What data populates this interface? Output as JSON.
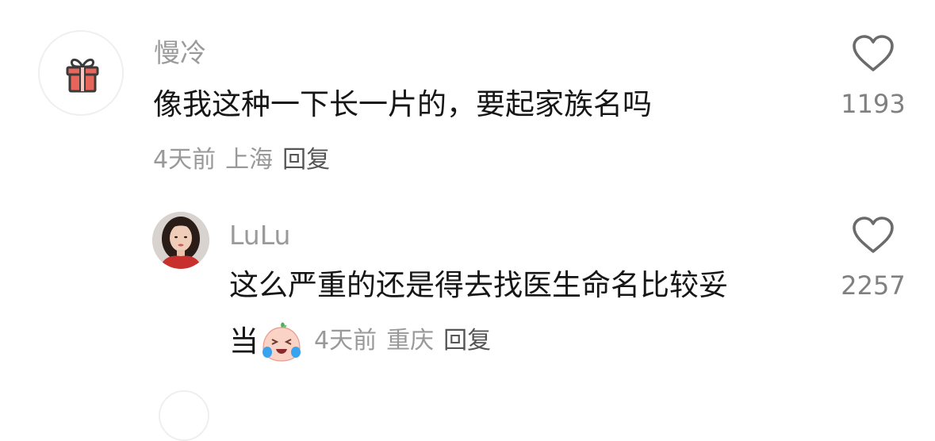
{
  "comments": [
    {
      "username": "慢冷",
      "avatar_icon": "gift-icon",
      "text": "像我这种一下长一片的，要起家族名吗",
      "time": "4天前",
      "location": "上海",
      "reply_label": "回复",
      "like_icon": "heart-outline-icon",
      "like_count": "1193"
    },
    {
      "username": "LuLu",
      "avatar_icon": "user-photo",
      "text_line1": "这么严重的还是得去找医生命名比较妥",
      "text_line2": "当",
      "emoji_icon": "crying-laughing-peach-icon",
      "time": "4天前",
      "location": "重庆",
      "reply_label": "回复",
      "like_icon": "heart-outline-icon",
      "like_count": "2257"
    }
  ],
  "colors": {
    "username": "#9a9a9a",
    "content": "#161616",
    "meta": "#999999",
    "reply": "#555555",
    "like_count": "#808080",
    "gift_red": "#e8655c"
  }
}
